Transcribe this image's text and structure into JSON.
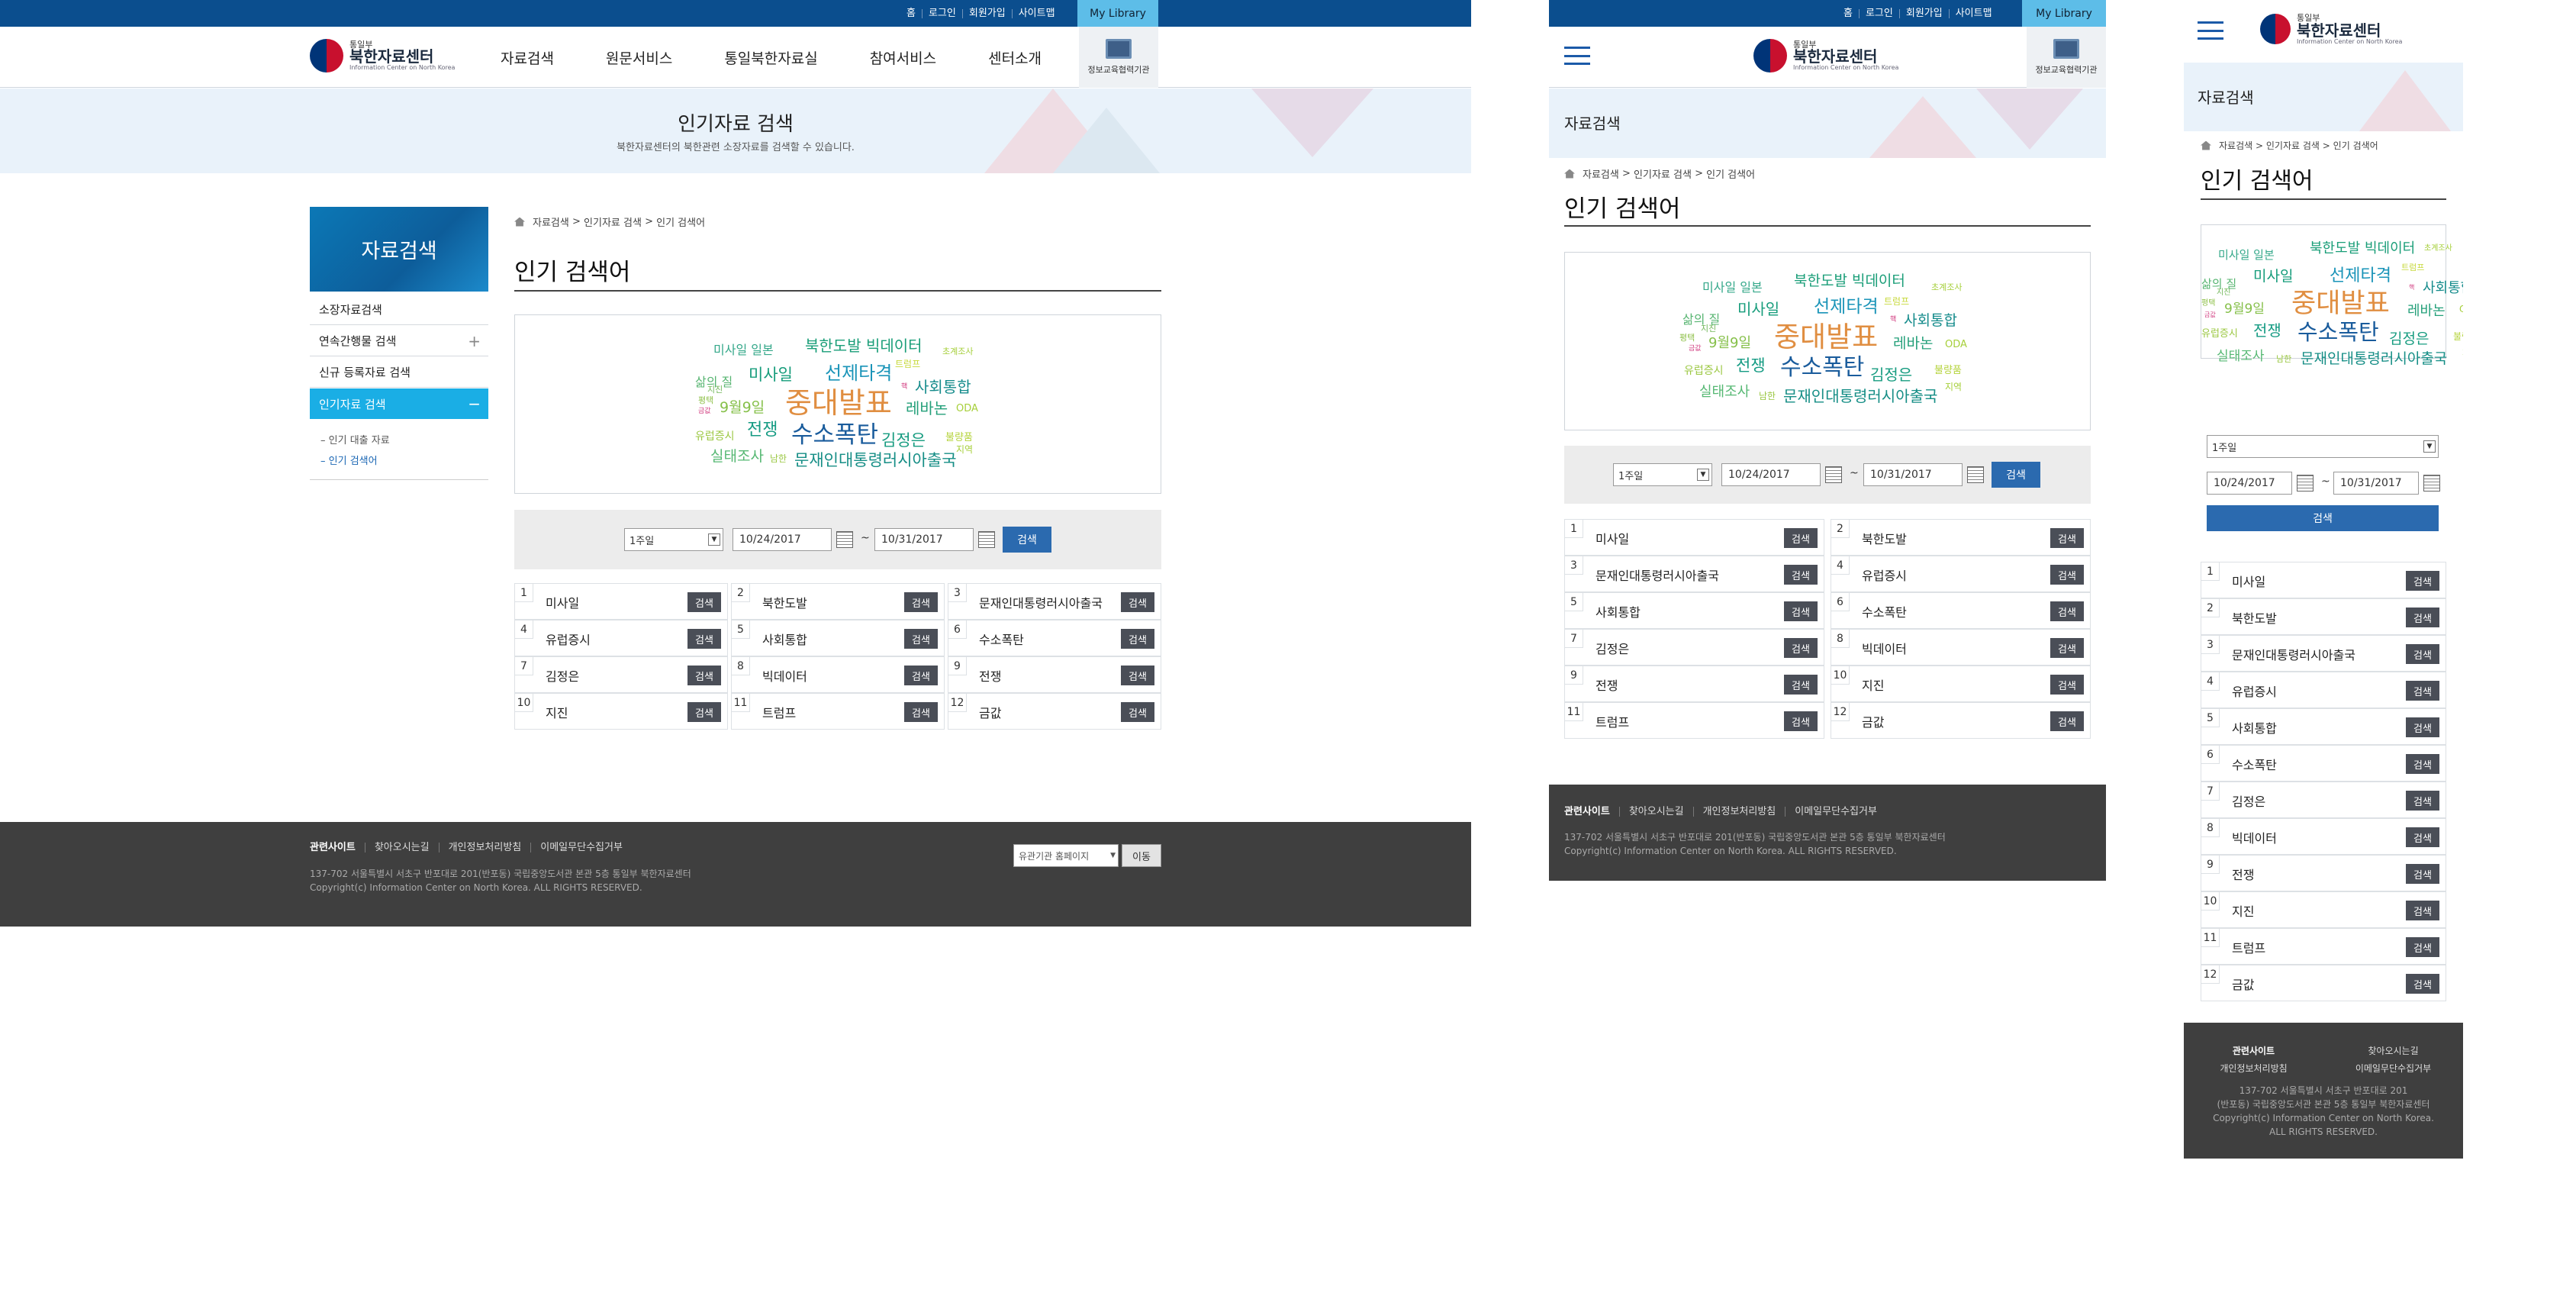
{
  "topbar": {
    "home": "홈",
    "login": "로그인",
    "join": "회원가입",
    "sitemap": "사이트맵",
    "my_library": "My Library"
  },
  "brand": {
    "ministry": "통일부",
    "name": "북한자료센터",
    "english": "Information Center on North Korea"
  },
  "gnb": [
    "자료검색",
    "원문서비스",
    "통일북한자료실",
    "참여서비스",
    "센터소개"
  ],
  "edu_link": "정보교육협력기관",
  "banner": {
    "title": "인기자료 검색",
    "subtitle": "북한자료센터의 북한관련 소장자료를 검색할 수 있습니다.",
    "section": "자료검색"
  },
  "sidebar": {
    "title": "자료검색",
    "items": [
      "소장자료검색",
      "연속간행물 검색",
      "신규 등록자료 검색",
      "인기자료 검색"
    ],
    "subitems": [
      "인기 대출 자료",
      "인기 검색어"
    ],
    "plus": "+",
    "minus": "−"
  },
  "breadcrumb": [
    "자료검색",
    "인기자료 검색",
    "인기 검색어"
  ],
  "breadcrumb_sep": ">",
  "page_title": "인기 검색어",
  "wordcloud": [
    {
      "text": "미사일 일본",
      "color": "#35a88a"
    },
    {
      "text": "북한도발 빅데이터",
      "color": "#1a9e78"
    },
    {
      "text": "초계조사",
      "color": "#a5cf3a"
    },
    {
      "text": "트럼프",
      "color": "#c7d93c"
    },
    {
      "text": "삶의 질",
      "color": "#58b572"
    },
    {
      "text": "미사일",
      "color": "#169c7b"
    },
    {
      "text": "선제타격",
      "color": "#1a94b8"
    },
    {
      "text": "핵",
      "color": "#d13b7f"
    },
    {
      "text": "사회통합",
      "color": "#168c8c"
    },
    {
      "text": "지진",
      "color": "#72b75a"
    },
    {
      "text": "중대발표",
      "color": "#e08e41"
    },
    {
      "text": "평택",
      "color": "#8fc04a"
    },
    {
      "text": "레바논",
      "color": "#25a07a"
    },
    {
      "text": "ODA",
      "color": "#a6cf3a"
    },
    {
      "text": "금값",
      "color": "#d13b7f"
    },
    {
      "text": "9월9일",
      "color": "#86c04a"
    },
    {
      "text": "유럽증시",
      "color": "#9cc843"
    },
    {
      "text": "전쟁",
      "color": "#159b83"
    },
    {
      "text": "수소폭탄",
      "color": "#1a5c9c"
    },
    {
      "text": "김정은",
      "color": "#179c80"
    },
    {
      "text": "불량품",
      "color": "#b5d33c"
    },
    {
      "text": "실태조사",
      "color": "#56b873"
    },
    {
      "text": "남한",
      "color": "#9ac742"
    },
    {
      "text": "문재인대통령러시아출국",
      "color": "#168e86"
    },
    {
      "text": "지역",
      "color": "#a6cf3a"
    }
  ],
  "search": {
    "period": "1주일",
    "start_date": "10/24/2017",
    "end_date": "10/31/2017",
    "tilde": "~",
    "button": "검색"
  },
  "ranking": [
    {
      "rank": "1",
      "term": "미사일"
    },
    {
      "rank": "2",
      "term": "북한도발"
    },
    {
      "rank": "3",
      "term": "문재인대통령러시아출국"
    },
    {
      "rank": "4",
      "term": "유럽증시"
    },
    {
      "rank": "5",
      "term": "사회통합"
    },
    {
      "rank": "6",
      "term": "수소폭탄"
    },
    {
      "rank": "7",
      "term": "김정은"
    },
    {
      "rank": "8",
      "term": "빅데이터"
    },
    {
      "rank": "9",
      "term": "전쟁"
    },
    {
      "rank": "10",
      "term": "지진"
    },
    {
      "rank": "11",
      "term": "트럼프"
    },
    {
      "rank": "12",
      "term": "금값"
    }
  ],
  "rank_button": "검색",
  "footer": {
    "links": [
      "관련사이트",
      "찾아오시는길",
      "개인정보처리방침",
      "이메일무단수집거부"
    ],
    "address": "137-702 서울특별시 서초구 반포대로 201(반포동) 국립중앙도서관 본관 5층 통일부 북한자료센터",
    "address_line1": "137-702 서울특별시 서초구 반포대로 201",
    "address_line2": "(반포동) 국립중앙도서관 본관 5층 통일부 북한자료센터",
    "copyright": "Copyright(c) Information Center on North Korea. ALL RIGHTS RESERVED.",
    "copyright_line1": "Copyright(c) Information Center on North Korea.",
    "copyright_line2": "ALL RIGHTS RESERVED.",
    "family_select": "유관기관 홈페이지",
    "go_button": "이동"
  },
  "colors": {
    "utility_bar": "#0b4e8e",
    "accent": "#1aaee5",
    "search_button": "#2b6aaf",
    "footer": "#3f3f3f"
  }
}
